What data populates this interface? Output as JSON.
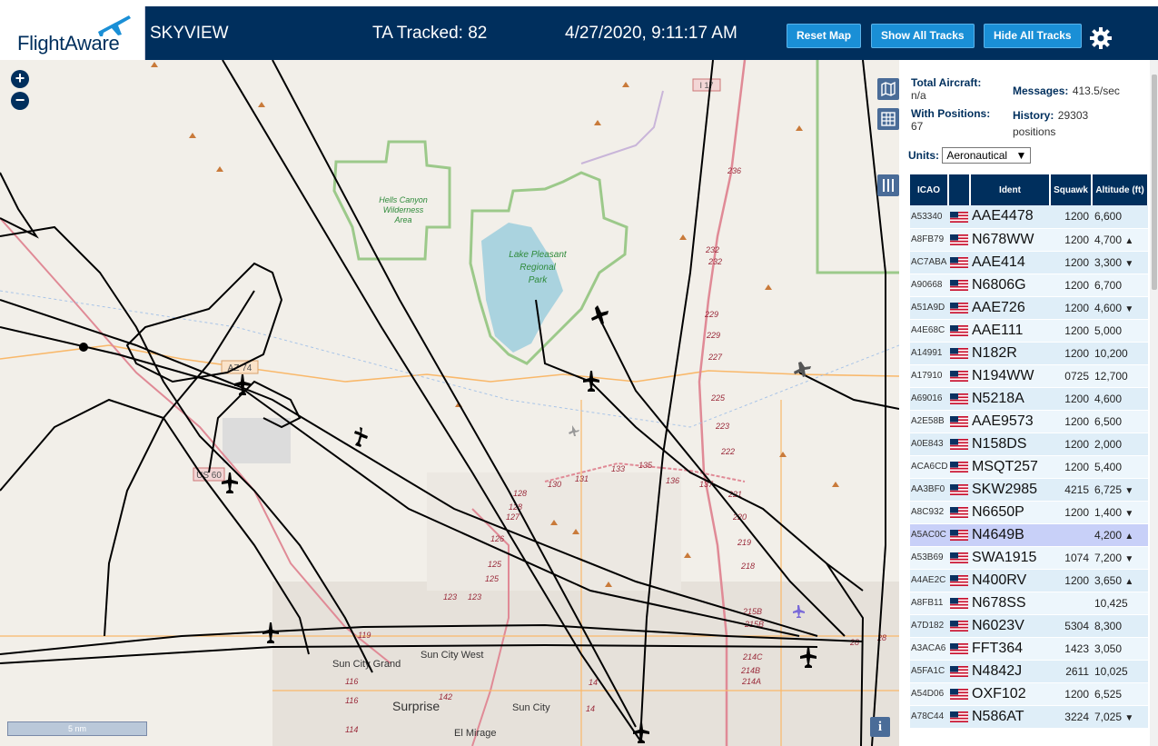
{
  "header": {
    "logo": "FlightAware",
    "title": "SKYVIEW",
    "tracked": "TA Tracked: 82",
    "datetime": "4/27/2020, 9:11:17 AM",
    "buttons": {
      "reset": "Reset Map",
      "show_all": "Show All Tracks",
      "hide_all": "Hide All Tracks"
    }
  },
  "map": {
    "zoom_in": "+",
    "zoom_out": "−",
    "scale": "5 nm",
    "info": "i",
    "labels": {
      "hells_canyon": [
        "Hells Canyon",
        "Wilderness",
        "Area"
      ],
      "lake_pleasant": [
        "Lake Pleasant",
        "Regional",
        "Park"
      ],
      "i17": "I 17",
      "az74": "AZ 74",
      "us60": "US 60",
      "sun_city_grand": "Sun City Grand",
      "sun_city_west": "Sun City West",
      "surprise": "Surprise",
      "sun_city": "Sun City",
      "el_mirage": "El Mirage"
    },
    "mile_markers": [
      "236",
      "232",
      "232",
      "229",
      "229",
      "227",
      "225",
      "223",
      "222",
      "221",
      "220",
      "219",
      "218",
      "215B",
      "215B",
      "214C",
      "214B",
      "214A",
      "131",
      "133",
      "135",
      "136",
      "137",
      "130",
      "128",
      "128",
      "127",
      "126",
      "125",
      "125",
      "123",
      "123",
      "119",
      "116",
      "116",
      "114",
      "142",
      "14",
      "14",
      "28",
      "28"
    ]
  },
  "stats": {
    "total_aircraft_label": "Total Aircraft:",
    "total_aircraft_value": "n/a",
    "with_positions_label": "With Positions:",
    "with_positions_value": "67",
    "messages_label": "Messages:",
    "messages_value": "413.5/sec",
    "history_label": "History:",
    "history_value": "29303 positions",
    "units_label": "Units:",
    "units_value": "Aeronautical"
  },
  "table": {
    "headers": [
      "ICAO",
      "",
      "Ident",
      "Squawk",
      "Altitude (ft)"
    ],
    "rows": [
      {
        "icao": "A53340",
        "ident": "AAE4478",
        "squawk": "1200",
        "alt": "6,600",
        "arrow": ""
      },
      {
        "icao": "A8FB79",
        "ident": "N678WW",
        "squawk": "1200",
        "alt": "4,700",
        "arrow": "▲"
      },
      {
        "icao": "AC7ABA",
        "ident": "AAE414",
        "squawk": "1200",
        "alt": "3,300",
        "arrow": "▼"
      },
      {
        "icao": "A90668",
        "ident": "N6806G",
        "squawk": "1200",
        "alt": "6,700",
        "arrow": ""
      },
      {
        "icao": "A51A9D",
        "ident": "AAE726",
        "squawk": "1200",
        "alt": "4,600",
        "arrow": "▼"
      },
      {
        "icao": "A4E68C",
        "ident": "AAE111",
        "squawk": "1200",
        "alt": "5,000",
        "arrow": ""
      },
      {
        "icao": "A14991",
        "ident": "N182R",
        "squawk": "1200",
        "alt": "10,200",
        "arrow": ""
      },
      {
        "icao": "A17910",
        "ident": "N194WW",
        "squawk": "0725",
        "alt": "12,700",
        "arrow": ""
      },
      {
        "icao": "A69016",
        "ident": "N5218A",
        "squawk": "1200",
        "alt": "4,600",
        "arrow": ""
      },
      {
        "icao": "A2E58B",
        "ident": "AAE9573",
        "squawk": "1200",
        "alt": "6,500",
        "arrow": ""
      },
      {
        "icao": "A0E843",
        "ident": "N158DS",
        "squawk": "1200",
        "alt": "2,000",
        "arrow": ""
      },
      {
        "icao": "ACA6CD",
        "ident": "MSQT257",
        "squawk": "1200",
        "alt": "5,400",
        "arrow": ""
      },
      {
        "icao": "AA3BF0",
        "ident": "SKW2985",
        "squawk": "4215",
        "alt": "6,725",
        "arrow": "▼"
      },
      {
        "icao": "A8C932",
        "ident": "N6650P",
        "squawk": "1200",
        "alt": "1,400",
        "arrow": "▼"
      },
      {
        "icao": "A5AC0C",
        "ident": "N4649B",
        "squawk": "",
        "alt": "4,200",
        "arrow": "▲",
        "selected": true
      },
      {
        "icao": "A53B69",
        "ident": "SWA1915",
        "squawk": "1074",
        "alt": "7,200",
        "arrow": "▼"
      },
      {
        "icao": "A4AE2C",
        "ident": "N400RV",
        "squawk": "1200",
        "alt": "3,650",
        "arrow": "▲"
      },
      {
        "icao": "A8FB11",
        "ident": "N678SS",
        "squawk": "",
        "alt": "10,425",
        "arrow": ""
      },
      {
        "icao": "A7D182",
        "ident": "N6023V",
        "squawk": "5304",
        "alt": "8,300",
        "arrow": ""
      },
      {
        "icao": "A3ACA6",
        "ident": "FFT364",
        "squawk": "1423",
        "alt": "3,050",
        "arrow": ""
      },
      {
        "icao": "A5FA1C",
        "ident": "N4842J",
        "squawk": "2611",
        "alt": "10,025",
        "arrow": ""
      },
      {
        "icao": "A54D06",
        "ident": "OXF102",
        "squawk": "1200",
        "alt": "6,525",
        "arrow": ""
      },
      {
        "icao": "A78C44",
        "ident": "N586AT",
        "squawk": "3224",
        "alt": "7,025",
        "arrow": "▼"
      }
    ]
  },
  "colors": {
    "header_bg": "#002f5d",
    "button_bg": "#1a8fd6",
    "map_bg": "#f2efe9",
    "track": "#000000",
    "park_border": "#9cc98a",
    "highway": "#e08a96"
  },
  "icons": [
    "plane-logo-icon",
    "gear-icon",
    "map-layers-icon",
    "grid-icon",
    "columns-icon",
    "info-icon",
    "us-flag-icon",
    "aircraft-icon"
  ]
}
